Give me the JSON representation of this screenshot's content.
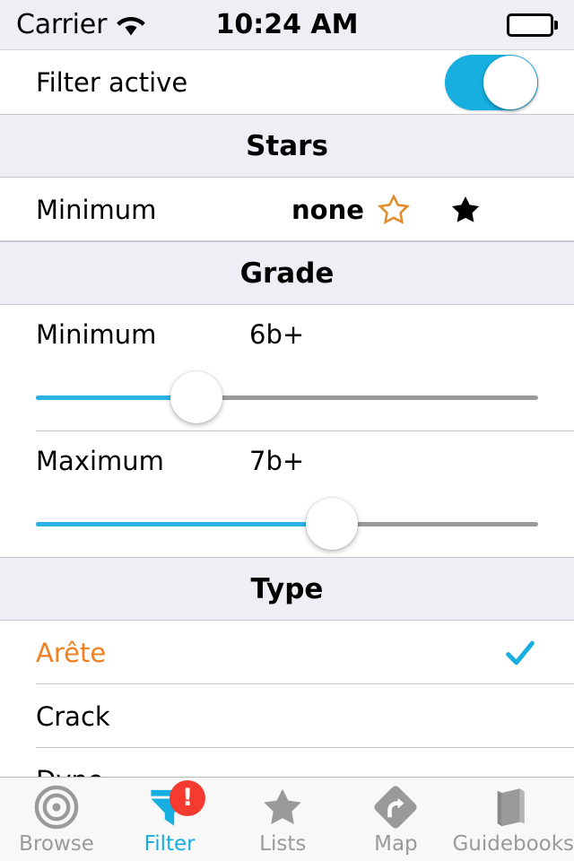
{
  "status_bar": {
    "carrier": "Carrier",
    "time": "10:24 AM",
    "wifi_icon": "wifi-icon",
    "battery_icon": "battery-full-icon"
  },
  "colors": {
    "accent_blue": "#17AEE0",
    "slider_blue": "#2BB3E8",
    "orange": "#F08020",
    "badge_red": "#F53B30",
    "header_bg": "#EFEEF4",
    "tab_gray": "#9a9a9a"
  },
  "filter_active": {
    "label": "Filter active",
    "toggle_state": "on"
  },
  "sections": [
    {
      "title": "Stars",
      "rows": [
        {
          "label": "Minimum",
          "value": "none",
          "stars": [
            "star-outline-icon",
            "star-filled-icon"
          ]
        }
      ]
    },
    {
      "title": "Grade",
      "rows": [
        {
          "label": "Minimum",
          "value": "6b+",
          "slider_percent": 32
        },
        {
          "label": "Maximum",
          "value": "7b+",
          "slider_percent": 59
        }
      ]
    },
    {
      "title": "Type",
      "rows": [
        {
          "label": "Arête",
          "selected": true,
          "check_icon": "checkmark-icon"
        },
        {
          "label": "Crack",
          "selected": false
        },
        {
          "label": "Dyno",
          "selected": false
        }
      ]
    }
  ],
  "tab_bar": {
    "active": "Filter",
    "tabs": [
      {
        "label": "Browse",
        "icon": "target-icon"
      },
      {
        "label": "Filter",
        "icon": "funnel-icon",
        "badge": "!"
      },
      {
        "label": "Lists",
        "icon": "star-icon"
      },
      {
        "label": "Map",
        "icon": "map-sign-icon"
      },
      {
        "label": "Guidebooks",
        "icon": "book-icon"
      }
    ]
  }
}
